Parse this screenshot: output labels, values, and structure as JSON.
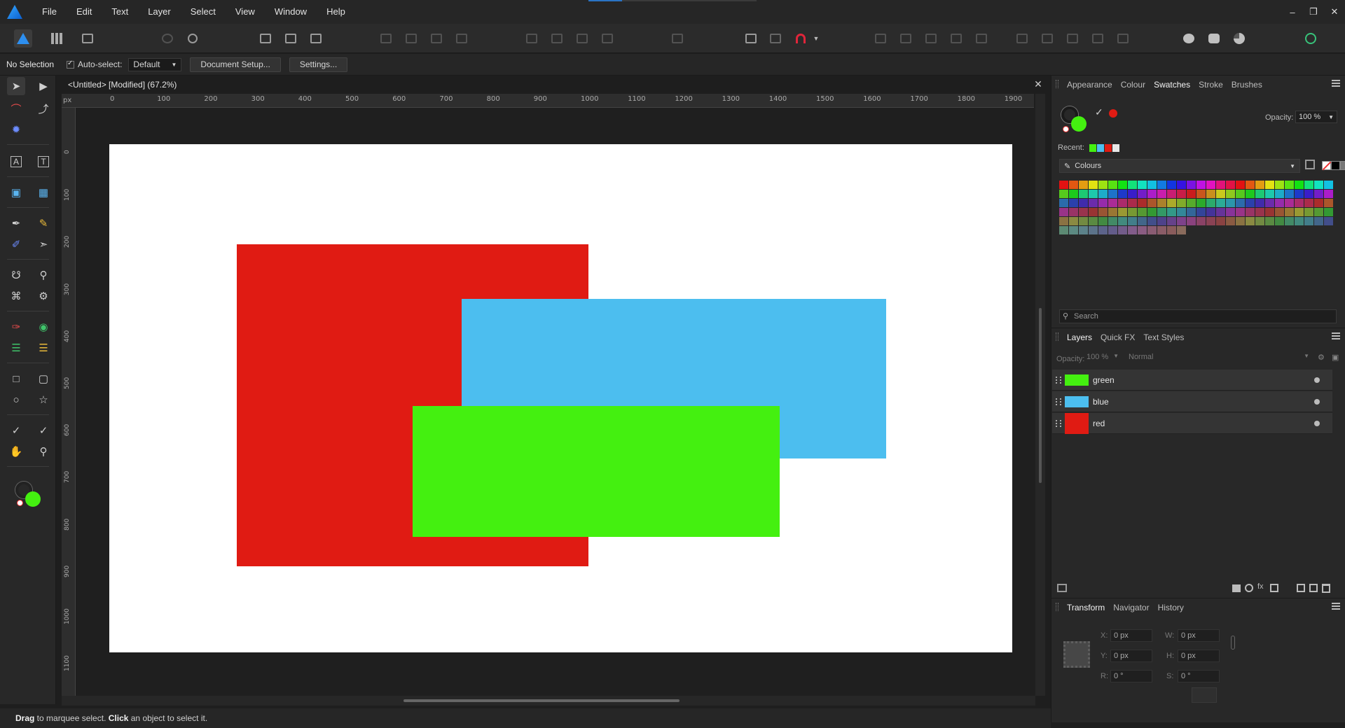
{
  "menubar": {
    "items": [
      "File",
      "Edit",
      "Text",
      "Layer",
      "Select",
      "View",
      "Window",
      "Help"
    ],
    "window_buttons": [
      "minimize-icon",
      "restore-icon",
      "close-icon"
    ]
  },
  "context": {
    "selection": "No Selection",
    "auto_select_label": "Auto-select:",
    "auto_select_value": "Default",
    "document_setup": "Document Setup...",
    "settings": "Settings..."
  },
  "document": {
    "title": "<Untitled> [Modified] (67.2%)",
    "ruler_unit": "px",
    "ruler_h_labels": [
      "0",
      "100",
      "200",
      "300",
      "400",
      "500",
      "600",
      "700",
      "800",
      "900",
      "1000",
      "1100",
      "1200",
      "1300",
      "1400",
      "1500",
      "1600",
      "1700",
      "1800",
      "1900"
    ],
    "ruler_v_labels": [
      "0",
      "100",
      "200",
      "300",
      "400",
      "500",
      "600",
      "700",
      "800",
      "900",
      "1000",
      "1100"
    ],
    "shapes": [
      {
        "name": "red",
        "color": "#e01b13"
      },
      {
        "name": "blue",
        "color": "#4cbeef"
      },
      {
        "name": "green",
        "color": "#44f010"
      }
    ]
  },
  "colour_panel": {
    "tabs": [
      "Appearance",
      "Colour",
      "Swatches",
      "Stroke",
      "Brushes"
    ],
    "active_tab": "Swatches",
    "opacity_label": "Opacity:",
    "opacity_value": "100 %",
    "recent_label": "Recent:",
    "recent_colors": [
      "#44f010",
      "#4cbeef",
      "#e01b13",
      "#e8e8e8"
    ],
    "palette_name": "Colours",
    "fill_color": "#44f010",
    "stroke_color": "#1a1a1a"
  },
  "search": {
    "placeholder": "Search"
  },
  "layers_panel": {
    "tabs": [
      "Layers",
      "Quick FX",
      "Text Styles"
    ],
    "active_tab": "Layers",
    "opacity_label": "Opacity:",
    "opacity_value": "100 %",
    "blend_mode": "Normal",
    "layers": [
      {
        "name": "green",
        "color": "#44f010"
      },
      {
        "name": "blue",
        "color": "#4cbeef"
      },
      {
        "name": "red",
        "color": "#e01b13"
      }
    ]
  },
  "transform_panel": {
    "tabs": [
      "Transform",
      "Navigator",
      "History"
    ],
    "active_tab": "Transform",
    "x_label": "X:",
    "x_value": "0 px",
    "y_label": "Y:",
    "y_value": "0 px",
    "w_label": "W:",
    "w_value": "0 px",
    "h_label": "H:",
    "h_value": "0 px",
    "r_label": "R:",
    "r_value": "0 °",
    "s_label": "S:",
    "s_value": "0 °"
  },
  "status": {
    "bold1": "Drag",
    "text1": " to marquee select. ",
    "bold2": "Click",
    "text2": " an object to select it."
  }
}
